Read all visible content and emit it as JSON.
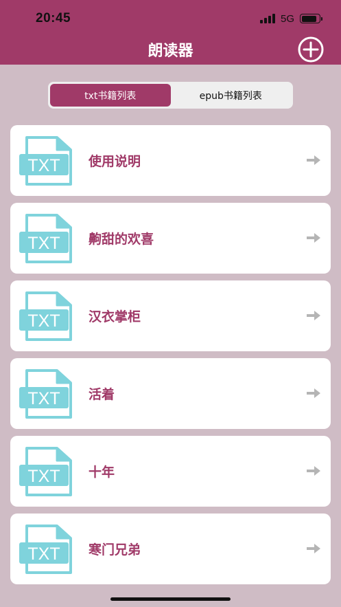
{
  "status_bar": {
    "time": "20:45",
    "network": "5G",
    "battery_level": 0.85
  },
  "header": {
    "title": "朗读器",
    "add_icon": "plus-circle-icon"
  },
  "tabs": [
    {
      "label": "txt书籍列表",
      "active": true
    },
    {
      "label": "epub书籍列表",
      "active": false
    }
  ],
  "books": [
    {
      "file_type": "TXT",
      "title": "使用说明"
    },
    {
      "file_type": "TXT",
      "title": "齁甜的欢喜"
    },
    {
      "file_type": "TXT",
      "title": "汉衣掌柜"
    },
    {
      "file_type": "TXT",
      "title": "活着"
    },
    {
      "file_type": "TXT",
      "title": "十年"
    },
    {
      "file_type": "TXT",
      "title": "寒门兄弟"
    }
  ],
  "colors": {
    "accent": "#a03a68",
    "background": "#cfbcc5",
    "file_icon": "#7fd3dc",
    "arrow": "#b5b5b5"
  }
}
